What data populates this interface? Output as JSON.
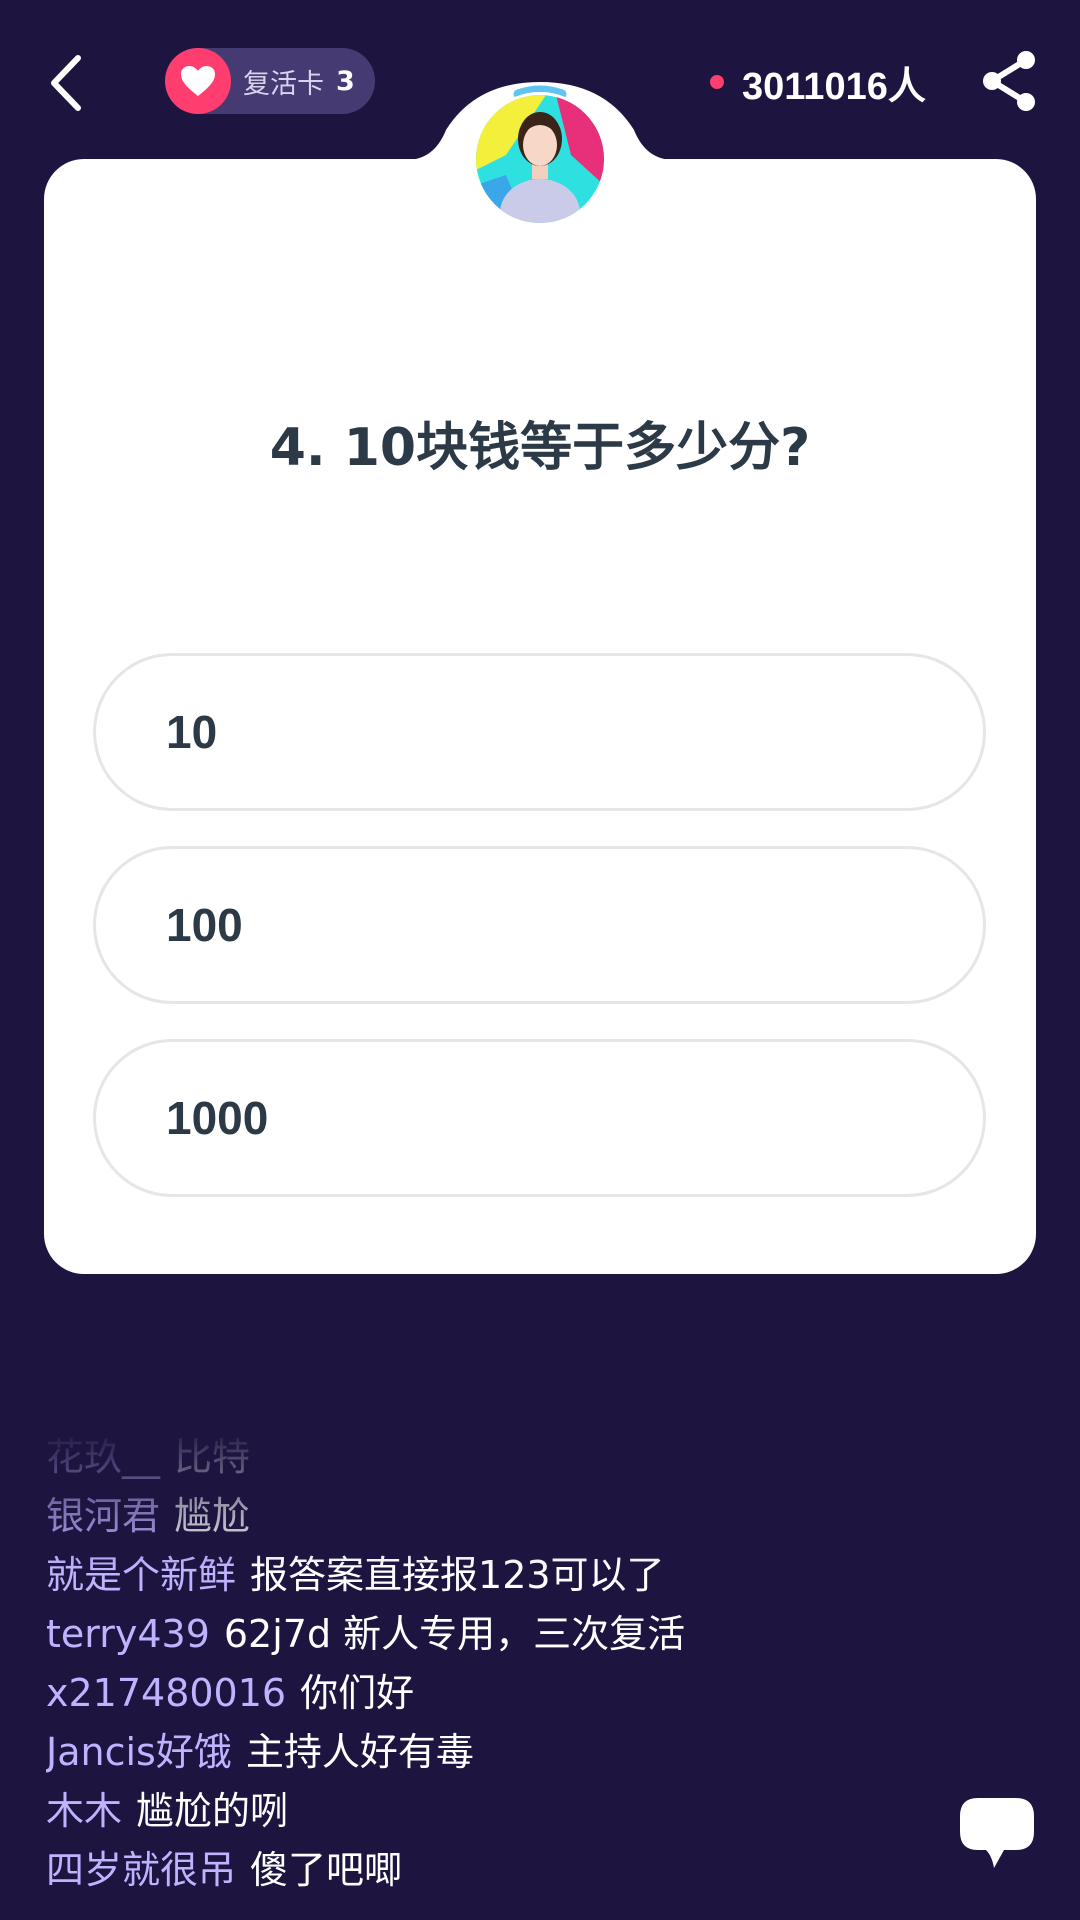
{
  "header": {
    "revive_card": {
      "label": "复活卡",
      "count": "3"
    },
    "viewer_count": "3011016人"
  },
  "question": {
    "text": "4. 10块钱等于多少分?",
    "options": [
      {
        "label": "10"
      },
      {
        "label": "100"
      },
      {
        "label": "1000"
      }
    ]
  },
  "chat": {
    "messages": [
      {
        "user": "花玖__",
        "text": "比特"
      },
      {
        "user": "银河君",
        "text": "尴尬"
      },
      {
        "user": "就是个新鲜",
        "text": "报答案直接报123可以了"
      },
      {
        "user": "terry439",
        "text": "62j7d 新人专用，三次复活"
      },
      {
        "user": "x217480016",
        "text": "你们好"
      },
      {
        "user": "Jancis好饿",
        "text": "主持人好有毒"
      },
      {
        "user": "木木",
        "text": "尴尬的咧"
      },
      {
        "user": "四岁就很吊",
        "text": "傻了吧唧"
      }
    ]
  },
  "colors": {
    "background": "#1d1540",
    "accent": "#ff3d6e",
    "username": "#bfb2ff",
    "card": "#ffffff"
  },
  "icons": {
    "back": "chevron-left-icon",
    "revive": "heart-icon",
    "share": "share-icon",
    "chat": "speech-bubble-icon"
  }
}
